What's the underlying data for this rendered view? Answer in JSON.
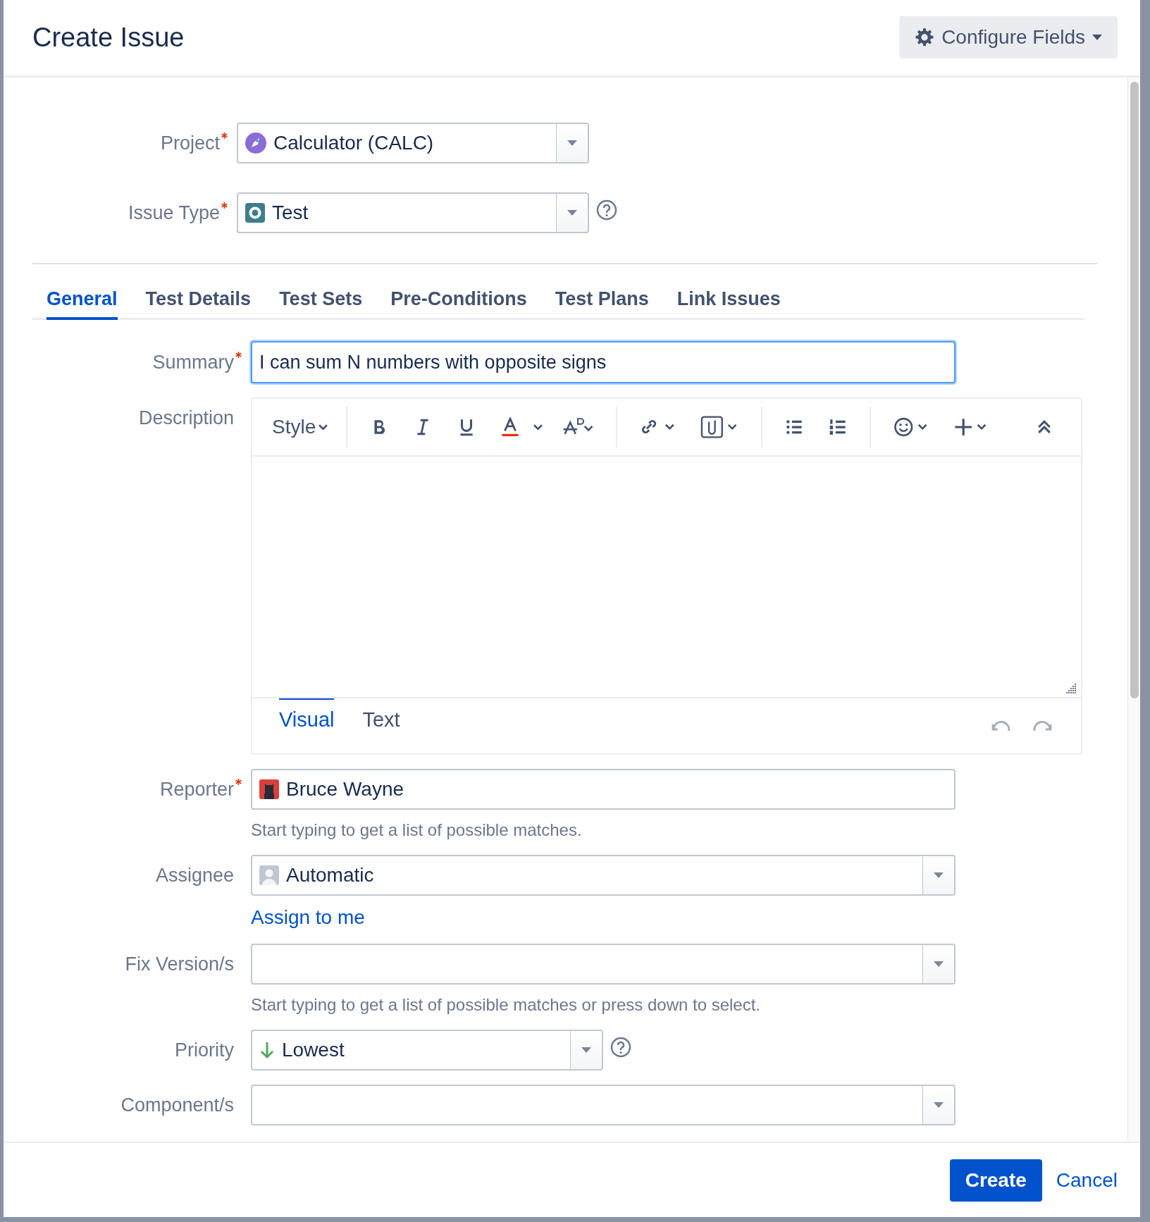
{
  "dialog": {
    "title": "Create Issue",
    "configure_button": "Configure Fields"
  },
  "top_fields": [
    {
      "kind": "project",
      "label": "Project",
      "required": true,
      "value": "Calculator (CALC)",
      "help": false
    },
    {
      "kind": "issue-type",
      "label": "Issue Type",
      "required": true,
      "value": "Test",
      "help": true
    }
  ],
  "tabs": [
    {
      "label": "General",
      "selected": true
    },
    {
      "label": "Test Details",
      "selected": false
    },
    {
      "label": "Test Sets",
      "selected": false
    },
    {
      "label": "Pre-Conditions",
      "selected": false
    },
    {
      "label": "Test Plans",
      "selected": false
    },
    {
      "label": "Link Issues",
      "selected": false
    }
  ],
  "fields": [
    {
      "kind": "text",
      "label": "Summary",
      "required": true,
      "value": "I can sum N numbers with opposite signs",
      "focused": true
    },
    {
      "kind": "editor",
      "label": "Description",
      "required": false,
      "style_menu": "Style",
      "modes": [
        {
          "label": "Visual",
          "selected": true
        },
        {
          "label": "Text",
          "selected": false
        }
      ]
    },
    {
      "kind": "reporter",
      "label": "Reporter",
      "required": true,
      "value": "Bruce Wayne",
      "hint": "Start typing to get a list of possible matches."
    },
    {
      "kind": "assignee",
      "label": "Assignee",
      "required": false,
      "value": "Automatic",
      "link": "Assign to me"
    },
    {
      "kind": "select",
      "label": "Fix Version/s",
      "required": false,
      "hint": "Start typing to get a list of possible matches or press down to select."
    },
    {
      "kind": "priority",
      "label": "Priority",
      "required": false,
      "value": "Lowest",
      "help": true
    },
    {
      "kind": "select",
      "label": "Component/s",
      "required": false
    }
  ],
  "footer": {
    "primary": "Create",
    "cancel": "Cancel"
  }
}
